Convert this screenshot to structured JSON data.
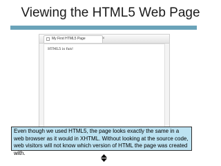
{
  "slide": {
    "title": "Viewing the HTML5 Web Page",
    "caption": "Even though we used HTML5, the page looks exactly the same in a web browser as it would in XHTML.  Without looking at the source code, web visitors will not know which version of HTML the page was created with."
  },
  "browser": {
    "tab_title": "My First HTML5 Page",
    "tab_close": "×",
    "page_text": "HTML5 is fun!"
  },
  "icons": {
    "tab_page_icon": "page-icon",
    "nav_icon": "navigation-arrows-icon"
  },
  "colors": {
    "title_rule": "#6aa3b9",
    "caption_bg": "#bde3f2"
  }
}
